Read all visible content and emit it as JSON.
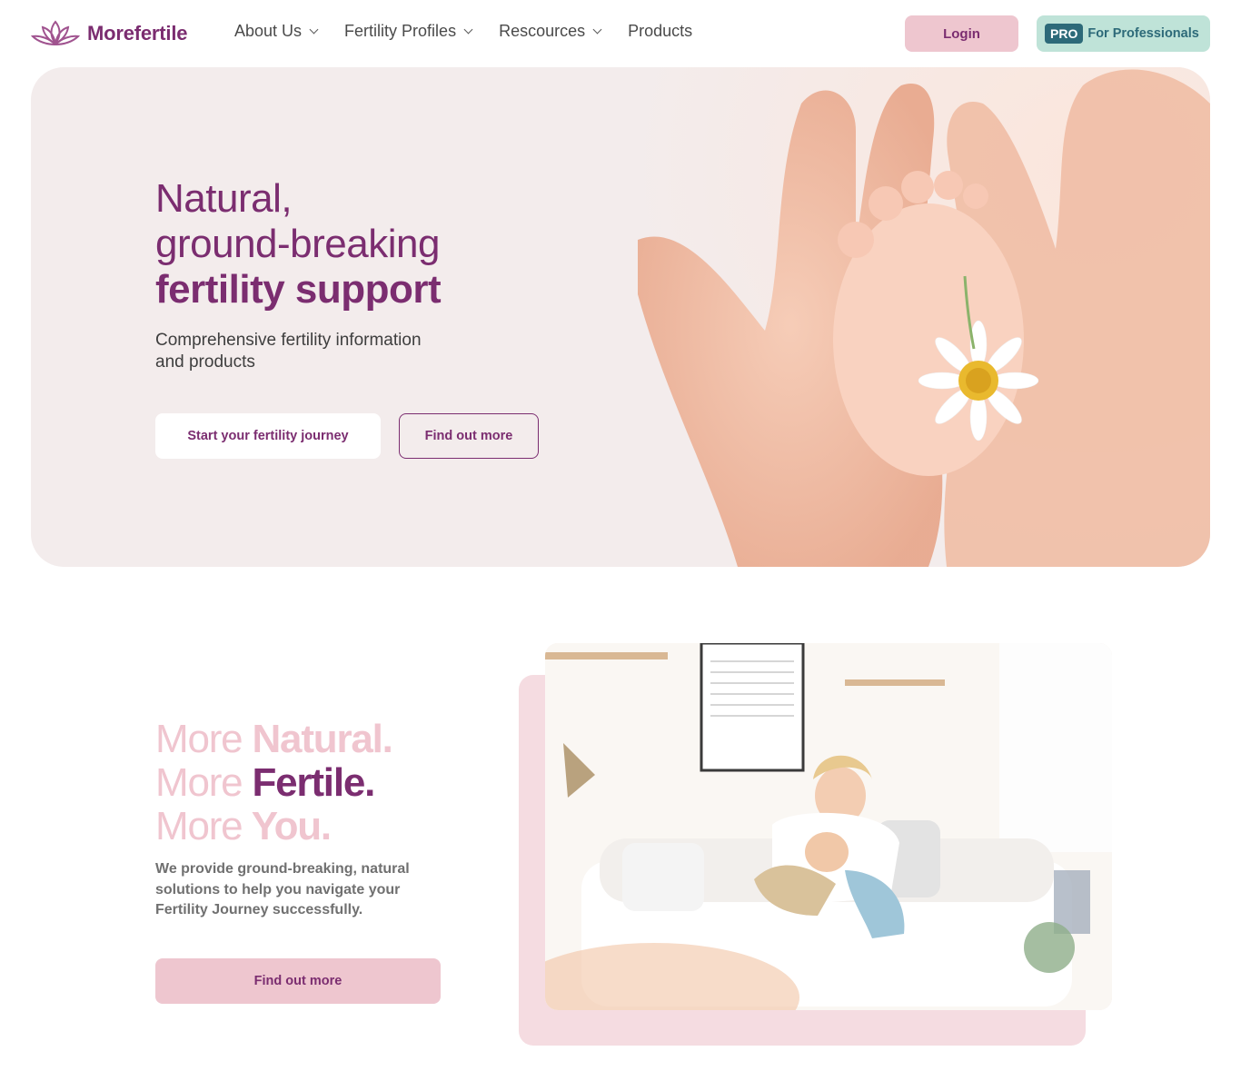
{
  "brand": {
    "name": "Morefertile",
    "logo_icon": "lotus-icon",
    "color": "#7b2d70"
  },
  "nav": {
    "items": [
      {
        "label": "About Us",
        "has_dropdown": true
      },
      {
        "label": "Fertility Profiles",
        "has_dropdown": true
      },
      {
        "label": "Rescources",
        "has_dropdown": true
      },
      {
        "label": "Products",
        "has_dropdown": false
      }
    ],
    "login_label": "Login",
    "pro_badge": "PRO",
    "pro_label": "For Professionals"
  },
  "hero": {
    "title_line1": "Natural,",
    "title_line2": "ground-breaking",
    "title_line3": "fertility support",
    "subtitle": "Comprehensive fertility information and products",
    "primary_cta": "Start your fertility journey",
    "secondary_cta": "Find out more",
    "background": "#f3ecec"
  },
  "section2": {
    "more_word": "More",
    "word1": "Natural.",
    "word2": "Fertile.",
    "word3": "You.",
    "body": "We provide ground-breaking, natural solutions to help you navigate your Fertility Journey successfully.",
    "cta": "Find out more",
    "accent_pink": "#f0c5cf"
  },
  "colors": {
    "plum": "#7b2d70",
    "pink_button": "#eec6cf",
    "teal_button": "#bfe3d8",
    "teal_text": "#2d6a79"
  }
}
